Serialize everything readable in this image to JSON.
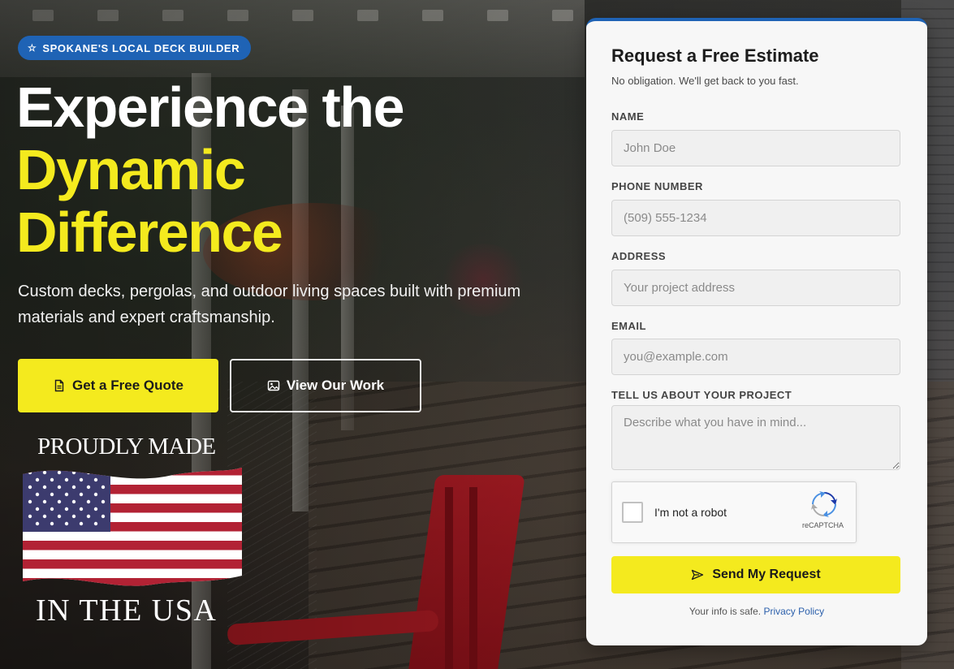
{
  "hero": {
    "badge": "SPOKANE'S LOCAL DECK BUILDER",
    "headline_line1": "Experience the",
    "headline_line2": "Dynamic",
    "headline_line3": "Difference",
    "subtext": "Custom decks, pergolas, and outdoor living spaces built with premium materials and expert craftsmanship.",
    "primary_button": "Get a Free Quote",
    "secondary_button": "View Our Work",
    "usa_top": "PROUDLY MADE",
    "usa_bottom": "IN THE USA"
  },
  "form": {
    "title": "Request a Free Estimate",
    "subtitle": "No obligation. We'll get back to you fast.",
    "fields": [
      {
        "label": "NAME",
        "placeholder": "John Doe"
      },
      {
        "label": "PHONE NUMBER",
        "placeholder": "(509) 555-1234"
      },
      {
        "label": "ADDRESS",
        "placeholder": "Your project address"
      },
      {
        "label": "EMAIL",
        "placeholder": "you@example.com"
      },
      {
        "label": "TELL US ABOUT YOUR PROJECT",
        "placeholder": "Describe what you have in mind..."
      }
    ],
    "recaptcha_label": "I'm not a robot",
    "recaptcha_brand": "reCAPTCHA",
    "submit": "Send My Request",
    "footnote_text": "Your info is safe.",
    "privacy_link": "Privacy Policy"
  },
  "colors": {
    "accent_yellow": "#f4ea1e",
    "brand_blue": "#1f63b5",
    "flag_red": "#b22234",
    "flag_blue": "#3c3b6e"
  },
  "icons": {
    "badge": "star-icon",
    "primary_button": "document-icon",
    "secondary_button": "image-icon",
    "submit": "send-icon"
  }
}
